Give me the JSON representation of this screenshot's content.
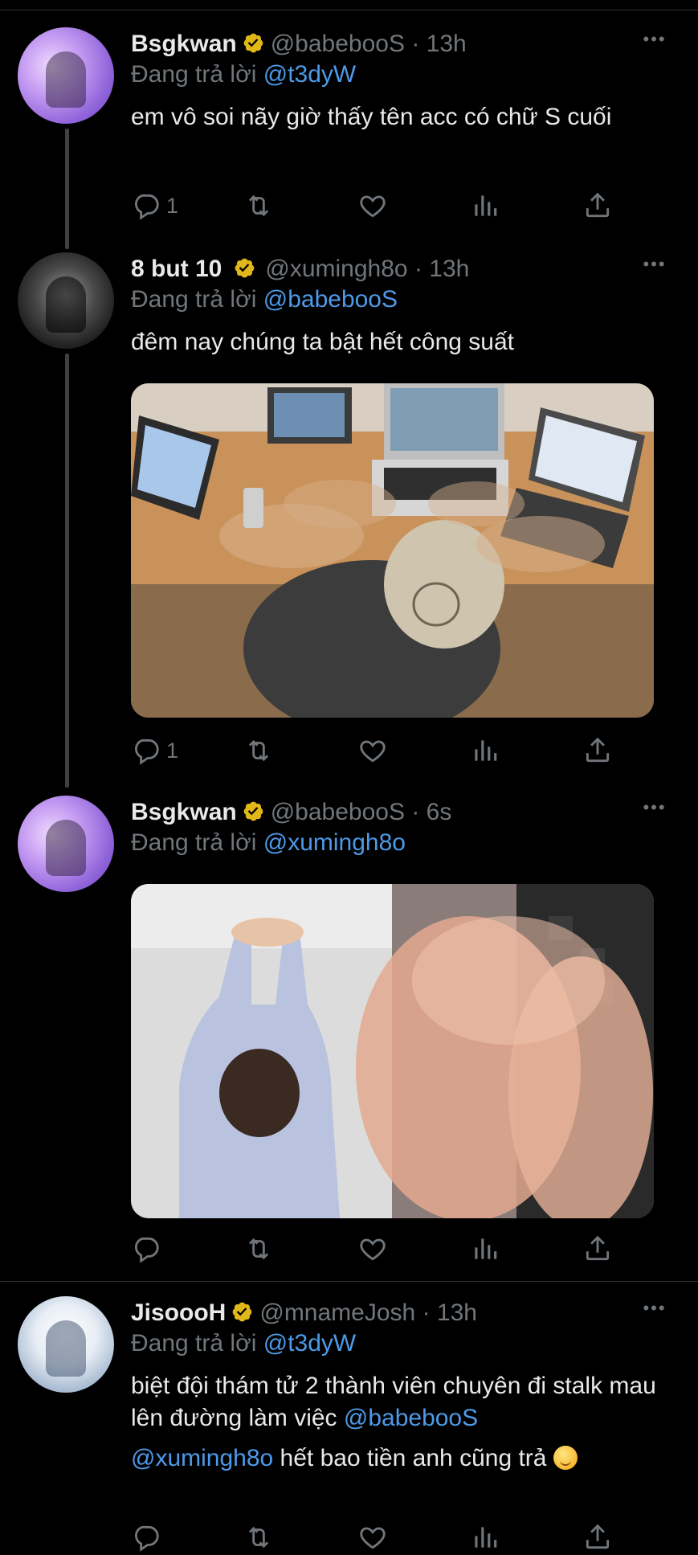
{
  "tweets": [
    {
      "name": "Bsgkwan",
      "handle": "@babebooS",
      "time": "· 13h",
      "reply_prefix": "Đang trả lời",
      "reply_to": "@t3dyW",
      "text": "em vô soi nãy giờ thấy tên acc có chữ S cuối",
      "reply_count": "1",
      "more_label": "•••"
    },
    {
      "name": "8 but 10",
      "handle": "@xumingh8o",
      "time": "· 13h",
      "reply_prefix": "Đang trả lời",
      "reply_to": "@babebooS",
      "text": "đêm nay chúng ta bật hết công suất",
      "reply_count": "1",
      "more_label": "•••",
      "media": "photo-office-laptops"
    },
    {
      "name": "Bsgkwan",
      "handle": "@babebooS",
      "time": "· 6s",
      "reply_prefix": "Đang trả lời",
      "reply_to": "@xumingh8o",
      "reply_count": "",
      "more_label": "•••",
      "media": "photo-stretch-typing"
    },
    {
      "name": "JisoooH",
      "handle": "@mnameJosh",
      "time": "· 13h",
      "reply_prefix": "Đang trả lời",
      "reply_to": "@t3dyW",
      "text_part1": "biệt đội thám tử 2 thành viên chuyên đi stalk mau lên đường làm việc ",
      "mention1": "@babebooS",
      "mention2": "@xumingh8o",
      "text_part2": " hết bao tiền anh cũng trả ",
      "emoji": "relieved-face",
      "reply_count": "",
      "more_label": "•••"
    }
  ],
  "icons": [
    "reply-icon",
    "retweet-icon",
    "like-icon",
    "views-icon",
    "share-icon",
    "verified-badge-icon",
    "more-icon"
  ],
  "colors": {
    "background": "#000000",
    "text": "#e7e9ea",
    "muted": "#71767b",
    "link": "#4d9ae9",
    "badge": "#e2b719"
  }
}
